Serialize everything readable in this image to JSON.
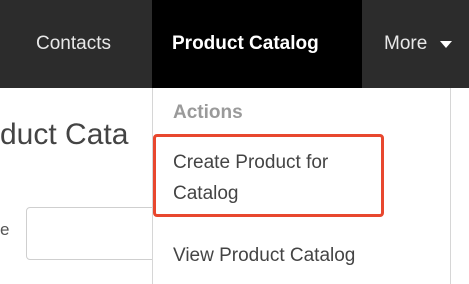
{
  "nav": {
    "items": [
      {
        "label": "Contacts"
      },
      {
        "label": "Product Catalog",
        "active": true
      },
      {
        "label": "More"
      }
    ]
  },
  "page": {
    "title": "duct Cata",
    "filter_label": "e"
  },
  "dropdown": {
    "header": "Actions",
    "items": [
      {
        "label": "Create Product for Catalog",
        "highlighted": true
      },
      {
        "label": "View Product Catalog"
      }
    ]
  },
  "colors": {
    "topbar": "#2c2c2c",
    "active_tab": "#000000",
    "highlight_border": "#e8472e"
  }
}
